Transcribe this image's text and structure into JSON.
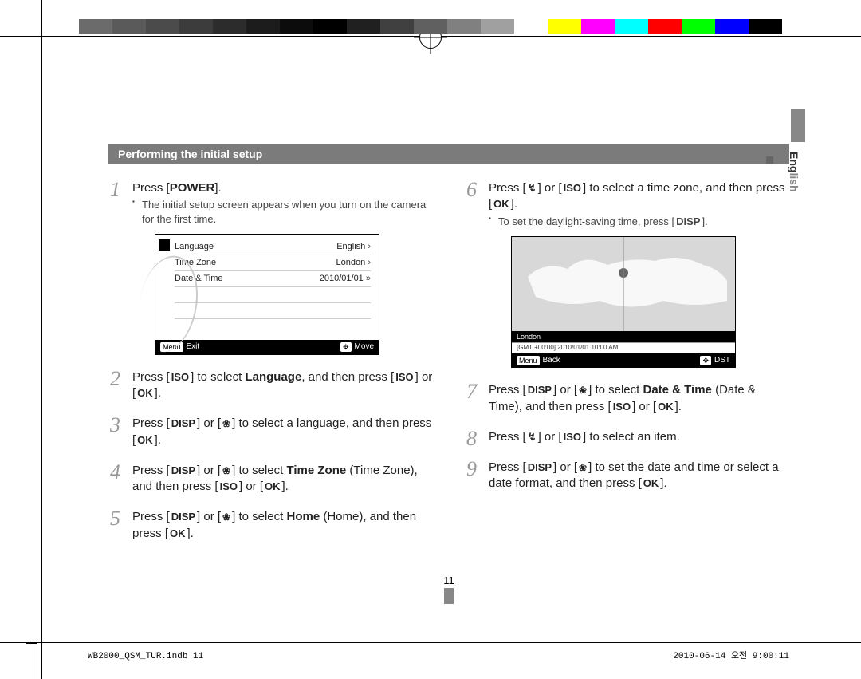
{
  "header": {
    "title": "Performing the initial setup"
  },
  "language_tab": "English",
  "page_number": "11",
  "steps_left": [
    {
      "text_parts": [
        "Press [",
        "POWER",
        "]."
      ],
      "sub": "The initial setup screen appears when you turn on the camera for the first time."
    },
    {
      "text_parts": [
        "Press [",
        "ISO",
        "] to select ",
        "Language",
        ", and then press [",
        "ISO",
        "] or [",
        "OK",
        "]."
      ]
    },
    {
      "text_parts": [
        "Press [",
        "DISP",
        "] or [",
        "macro",
        "] to select a language, and then press [",
        "OK",
        "]."
      ]
    },
    {
      "text_parts": [
        "Press [",
        "DISP",
        "] or [",
        "macro",
        "] to select ",
        "Time Zone",
        " (Time Zone), and then press [",
        "ISO",
        "] or [",
        "OK",
        "]."
      ]
    },
    {
      "text_parts": [
        "Press [",
        "DISP",
        "] or [",
        "macro",
        "] to select ",
        "Home",
        " (Home), and then press [",
        "OK",
        "]."
      ]
    }
  ],
  "steps_right": [
    {
      "text_parts": [
        "Press [",
        "lightning",
        "] or [",
        "ISO",
        "] to select a time zone, and then press [",
        "OK",
        "]."
      ],
      "sub": "To set the daylight-saving time, press [DISP]."
    },
    {
      "text_parts": [
        "Press [",
        "DISP",
        "] or [",
        "macro",
        "] to select ",
        "Date & Time",
        " (Date & Time), and then press [",
        "ISO",
        "] or [",
        "OK",
        "]."
      ]
    },
    {
      "text_parts": [
        "Press [",
        "lightning",
        "] or [",
        "ISO",
        "] to select an item."
      ]
    },
    {
      "text_parts": [
        "Press [",
        "DISP",
        "] or [",
        "macro",
        "] to set the date and time or select a date format, and then press [",
        "OK",
        "]."
      ]
    }
  ],
  "screen1": {
    "rows": [
      {
        "label": "Language",
        "value": "English"
      },
      {
        "label": "Time Zone",
        "value": "London"
      },
      {
        "label": "Date & Time",
        "value": "2010/01/01"
      }
    ],
    "footer": {
      "left_btn": "Menu",
      "left": "Exit",
      "right_btn": "✥",
      "right": "Move"
    }
  },
  "map_screen": {
    "city": "London",
    "gmt": "[GMT +00:00] 2010/01/01 10:00 AM",
    "footer": {
      "left_btn": "Menu",
      "left": "Back",
      "right_btn": "✥",
      "right": "DST"
    }
  },
  "footer": {
    "left": "WB2000_QSM_TUR.indb   11",
    "right": "2010-06-14   오전 9:00:11"
  },
  "colors": {
    "bar": [
      "#6b6b6b",
      "#5a5a5a",
      "#4b4b4b",
      "#3c3c3c",
      "#2c2c2c",
      "#1c1c1c",
      "#0c0c0c",
      "#000000",
      "#202020",
      "#404040",
      "#606060",
      "#808080",
      "#a0a0a0",
      "#ffffff",
      "#ffff00",
      "#ff00ff",
      "#00ffff",
      "#ff0000",
      "#00ff00",
      "#0000ff",
      "#000000"
    ]
  }
}
